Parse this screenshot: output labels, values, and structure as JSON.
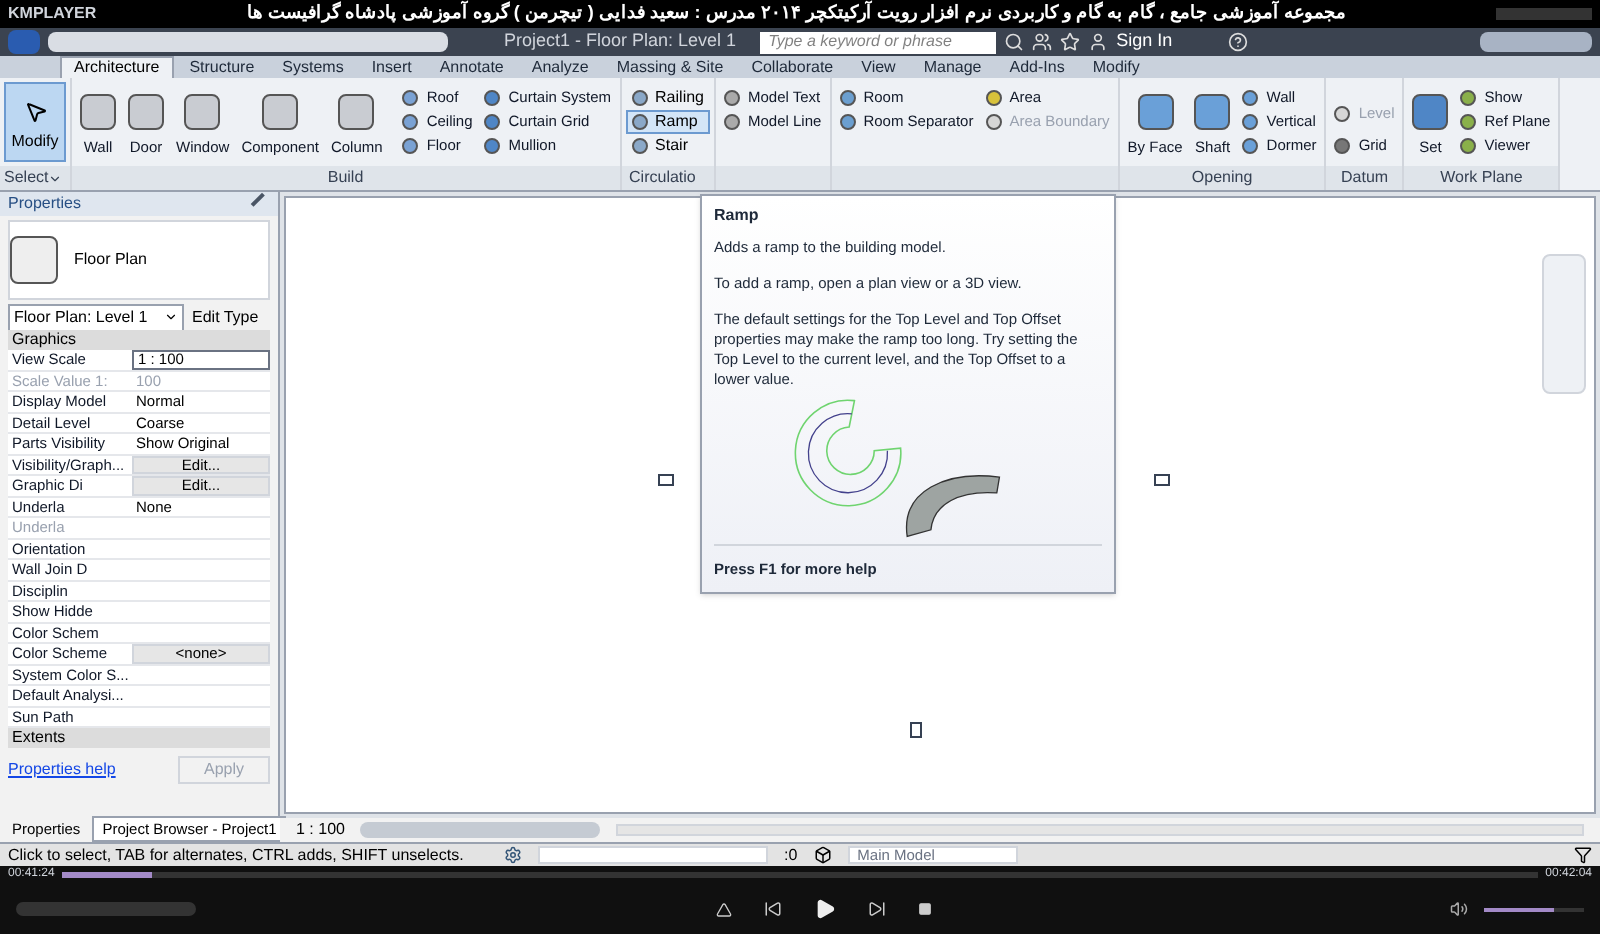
{
  "player": {
    "brand": "KMPLAYER",
    "title": "مجموعه آموزشی جامع ، گام به گام و کاربردی نرم افزار رویت آرکیتکچر ۲۰۱۴   مدرس : سعید فدایی ( تیچرمن ) گروه آموزشی پادشاه گرافیست ها",
    "elapsed": "00:41:24",
    "total": "00:42:04",
    "progress": {
      "level": 0.06
    },
    "volume": {
      "level": 0.7
    }
  },
  "app": {
    "title": "Project1 - Floor Plan: Level 1",
    "search": {
      "placeholder": "Type a keyword or phrase"
    },
    "sign_in": "Sign In"
  },
  "tabs": [
    {
      "label": "Architecture",
      "selected": true
    },
    {
      "label": "Structure",
      "selected": false
    },
    {
      "label": "Systems",
      "selected": false
    },
    {
      "label": "Insert",
      "selected": false
    },
    {
      "label": "Annotate",
      "selected": false
    },
    {
      "label": "Analyze",
      "selected": false
    },
    {
      "label": "Massing & Site",
      "selected": false
    },
    {
      "label": "Collaborate",
      "selected": false
    },
    {
      "label": "View",
      "selected": false
    },
    {
      "label": "Manage",
      "selected": false
    },
    {
      "label": "Add-Ins",
      "selected": false
    },
    {
      "label": "Modify",
      "selected": false
    }
  ],
  "ribbon": {
    "modify": {
      "label": "Modify",
      "selected": true
    },
    "select_label": "Select",
    "build": {
      "label": "Build",
      "large": [
        "Wall",
        "Door",
        "Window",
        "Component",
        "Column"
      ],
      "small": [
        {
          "label": "Roof",
          "disabled": false
        },
        {
          "label": "Ceiling",
          "disabled": false
        },
        {
          "label": "Floor",
          "disabled": false
        },
        {
          "label": "Curtain System",
          "disabled": false
        },
        {
          "label": "Curtain Grid",
          "disabled": false
        },
        {
          "label": "Mullion",
          "disabled": false
        }
      ]
    },
    "circulation": {
      "label": "Circulatio",
      "items": [
        {
          "label": "Railing",
          "selected": false
        },
        {
          "label": "Ramp",
          "selected": true
        },
        {
          "label": "Stair",
          "selected": false
        }
      ]
    },
    "model": [
      {
        "label": "Model Text",
        "disabled": false
      },
      {
        "label": "Model Line",
        "disabled": false
      }
    ],
    "room": [
      {
        "label": "Room",
        "disabled": false
      },
      {
        "label": "Room Separator",
        "disabled": false
      },
      {
        "label": "Area",
        "disabled": false
      },
      {
        "label": "Area Boundary",
        "disabled": true
      }
    ],
    "opening": {
      "label": "Opening",
      "large": [
        "By Face",
        "Shaft"
      ],
      "small": [
        "Wall",
        "Vertical",
        "Dormer"
      ]
    },
    "datum": {
      "label": "Datum",
      "items": [
        {
          "label": "Level",
          "disabled": true
        },
        {
          "label": "Grid",
          "disabled": false
        }
      ]
    },
    "work_plane": {
      "label": "Work Plane",
      "large": "Set",
      "small": [
        "Show",
        "Ref Plane",
        "Viewer"
      ]
    }
  },
  "tooltip": {
    "title": "Ramp",
    "summary": "Adds a ramp to the building model.",
    "paragraphs": [
      "To add a ramp, open a plan view or a 3D view.",
      "The default settings for the Top Level and Top Offset properties may make the ramp too long. Try setting the Top Level to the current level, and the Top Offset to a lower value."
    ],
    "footer": "Press F1 for more help"
  },
  "properties": {
    "title": "Properties",
    "type_name": "Floor Plan",
    "view_selector": "Floor Plan: Level 1",
    "edit_type": "Edit Type",
    "group": "Graphics",
    "rows": [
      {
        "name": "View Scale",
        "value": "1 : 100",
        "kind": "input",
        "disabled": false
      },
      {
        "name": "Scale Value    1:",
        "value": "100",
        "kind": "text",
        "disabled": true
      },
      {
        "name": "Display Model",
        "value": "Normal",
        "kind": "text",
        "disabled": false
      },
      {
        "name": "Detail Level",
        "value": "Coarse",
        "kind": "text",
        "disabled": false
      },
      {
        "name": "Parts Visibility",
        "value": "Show Original",
        "kind": "text",
        "disabled": false
      },
      {
        "name": "Visibility/Graph...",
        "value": "Edit...",
        "kind": "button",
        "disabled": false
      },
      {
        "name": "Graphic Di",
        "value": "Edit...",
        "kind": "button",
        "disabled": false
      },
      {
        "name": "Underla",
        "value": "None",
        "kind": "text",
        "disabled": false
      },
      {
        "name": "Underla",
        "kind": "text",
        "disabled": true
      },
      {
        "name": "Orientation",
        "kind": "text",
        "disabled": false
      },
      {
        "name": "Wall Join D",
        "kind": "text",
        "disabled": false
      },
      {
        "name": "Disciplin",
        "kind": "text",
        "disabled": false
      },
      {
        "name": "Show Hidde",
        "kind": "text",
        "disabled": false
      },
      {
        "name": "Color Schem",
        "kind": "text",
        "disabled": false
      },
      {
        "name": "Color Scheme",
        "value": "<none>",
        "kind": "button",
        "disabled": false
      },
      {
        "name": "System Color S...",
        "kind": "text",
        "disabled": false
      },
      {
        "name": "Default Analysi...",
        "kind": "text",
        "disabled": false
      },
      {
        "name": "Sun Path",
        "kind": "text",
        "disabled": false
      }
    ],
    "extents": "Extents",
    "help_link": "Properties help",
    "apply": "Apply"
  },
  "browser_tabs": [
    {
      "label": "Properties",
      "selected": false
    },
    {
      "label": "Project Browser - Project1",
      "selected": true
    }
  ],
  "view_bar": {
    "scale": "1 : 100"
  },
  "status_bar": {
    "message": "Click to select, TAB for alternates, CTRL adds, SHIFT unselects.",
    "count": ":0",
    "workset": "Main Model"
  }
}
